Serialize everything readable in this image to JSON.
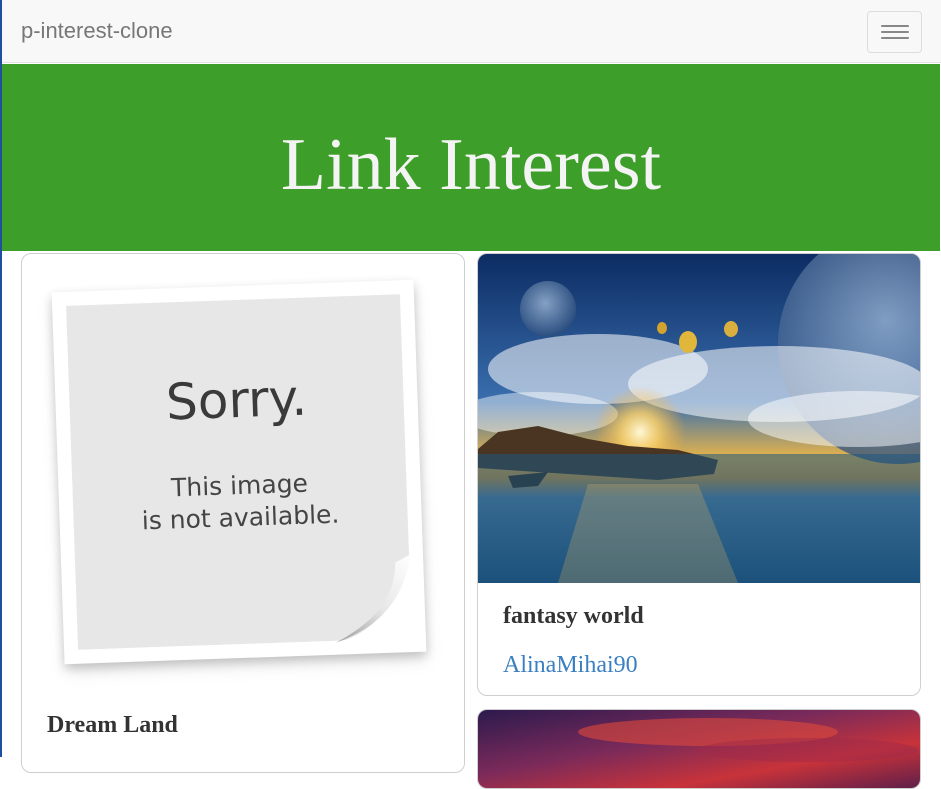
{
  "navbar": {
    "brand": "p-interest-clone",
    "menu_icon": "hamburger-icon"
  },
  "hero": {
    "title": "Link Interest",
    "background": "#3e9e2a"
  },
  "cards": [
    {
      "title": "Dream Land",
      "image": {
        "type": "placeholder",
        "main_text": "Sorry.",
        "sub_text_line1": "This image",
        "sub_text_line2": "is not available."
      }
    },
    {
      "title": "fantasy world",
      "user": "AlinaMihai90",
      "image": {
        "type": "photo",
        "subject": "fantasy-island-sunset"
      }
    },
    {
      "image": {
        "type": "photo",
        "subject": "red-sky"
      }
    }
  ],
  "colors": {
    "link": "#3a7fc1",
    "title": "#333333"
  }
}
